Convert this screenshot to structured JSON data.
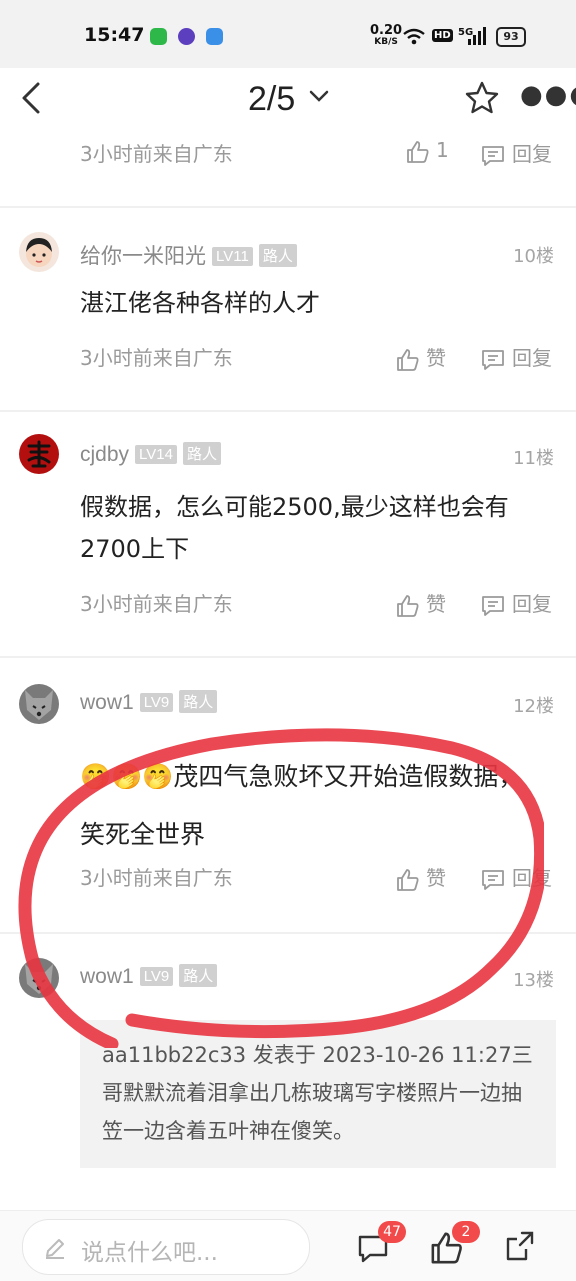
{
  "status_bar": {
    "time": "15:47",
    "net_speed": "0.20",
    "net_unit": "KB/S",
    "hd": "HD",
    "signal": "5G",
    "battery": "93"
  },
  "nav": {
    "page_indicator": "2/5"
  },
  "prev_comment": {
    "meta": "3小时前来自广东",
    "likes": "1",
    "reply": "回复"
  },
  "comments": [
    {
      "user": "给你一米阳光",
      "level": "LV11",
      "badge": "路人",
      "floor": "10楼",
      "text": "湛江佬各种各样的人才",
      "meta": "3小时前来自广东",
      "like": "赞",
      "reply": "回复"
    },
    {
      "user": "cjdby",
      "level": "LV14",
      "badge": "路人",
      "floor": "11楼",
      "text": "假数据，怎么可能2500,最少这样也会有2700上下",
      "meta": "3小时前来自广东",
      "like": "赞",
      "reply": "回复"
    },
    {
      "user": "wow1",
      "level": "LV9",
      "badge": "路人",
      "floor": "12楼",
      "emoji": "🤭🤭🤭",
      "text": "茂四气急败坏又开始造假数据，笑死全世界",
      "meta": "3小时前来自广东",
      "like": "赞",
      "reply": "回复"
    },
    {
      "user": "wow1",
      "level": "LV9",
      "badge": "路人",
      "floor": "13楼",
      "quote": "aa11bb22c33 发表于 2023-10-26 11:27三哥默默流着泪拿出几栋玻璃写字楼照片一边抽笠一边含着五叶神在傻笑。"
    }
  ],
  "bottom_bar": {
    "placeholder": "说点什么吧...",
    "comment_count": "47",
    "like_count": "2"
  },
  "colors": {
    "annotation": "#e8343f",
    "badge_red": "#f24a4a",
    "meta_gray": "#9a9a9a"
  }
}
